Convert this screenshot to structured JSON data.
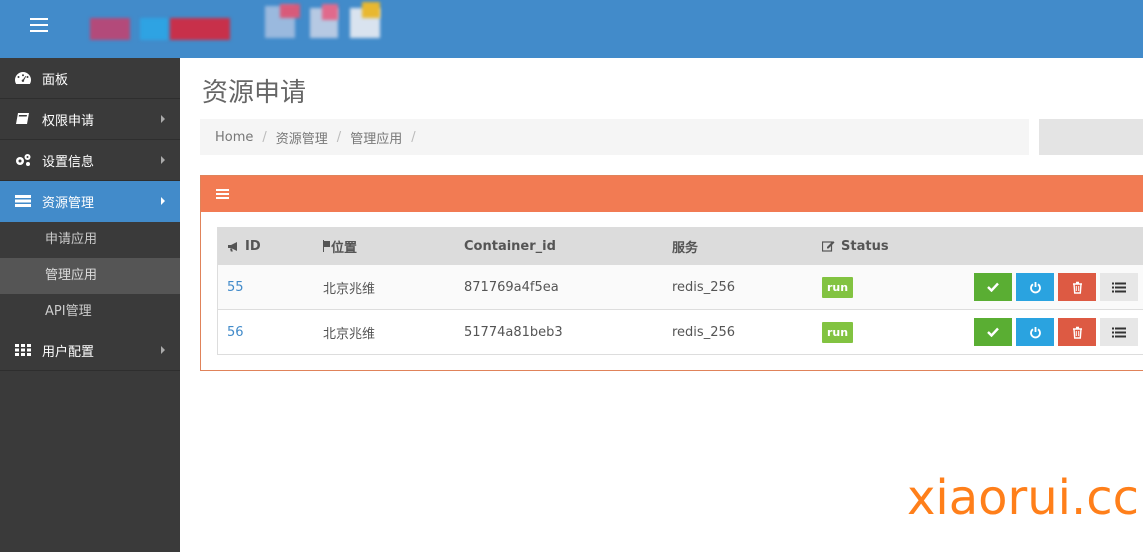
{
  "sidebar": {
    "items": [
      {
        "label": "面板",
        "icon": "dashboard-icon"
      },
      {
        "label": "权限申请",
        "icon": "book-icon"
      },
      {
        "label": "设置信息",
        "icon": "cogs-icon"
      },
      {
        "label": "资源管理",
        "icon": "list-icon",
        "active": true
      },
      {
        "label": "用户配置",
        "icon": "grid-icon"
      }
    ],
    "subitems": [
      "申请应用",
      "管理应用",
      "API管理"
    ]
  },
  "page": {
    "title": "资源申请"
  },
  "breadcrumb": [
    "Home",
    "资源管理",
    "管理应用"
  ],
  "table": {
    "headers": [
      "ID",
      "位置",
      "Container_id",
      "服务",
      "Status"
    ],
    "rows": [
      {
        "id": "55",
        "location": "北京兆维",
        "container_id": "871769a4f5ea",
        "service": "redis_256",
        "status": "run"
      },
      {
        "id": "56",
        "location": "北京兆维",
        "container_id": "51774a81beb3",
        "service": "redis_256",
        "status": "run"
      }
    ]
  },
  "colors": {
    "topbar": "#428bca",
    "sidebar": "#3a3a3a",
    "panel_header": "#f27b53",
    "run_tag": "#82c341"
  },
  "watermark": "xiaorui.cc"
}
